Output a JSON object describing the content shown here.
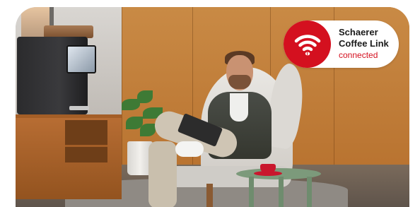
{
  "badge": {
    "brand_line1": "Schaerer",
    "brand_line2": "Coffee Link",
    "status": "connected",
    "icon": "wifi-icon",
    "accent_color": "#d4101f"
  },
  "photo": {
    "subject": "photo-scene"
  }
}
